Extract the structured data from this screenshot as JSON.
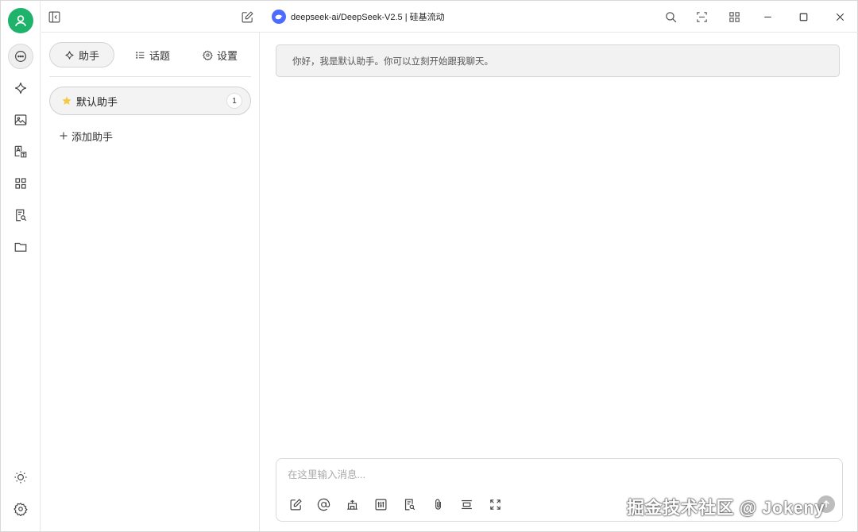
{
  "header": {
    "model_name": "deepseek-ai/DeepSeek-V2.5 | 硅基流动",
    "icons": [
      "sidebar-toggle-icon",
      "new-topic-icon",
      "search-icon",
      "scan-icon",
      "apps-icon",
      "minimize-icon",
      "maximize-icon",
      "close-icon"
    ]
  },
  "rail": {
    "icons": [
      "chat-icon",
      "sparkle-icon",
      "image-icon",
      "translate-icon",
      "grid-icon",
      "document-search-icon",
      "folder-icon",
      "theme-sun-icon",
      "settings-gear-icon"
    ],
    "active": "chat-icon"
  },
  "panel": {
    "tabs": [
      {
        "label": "助手",
        "icon": "sparkle-icon"
      },
      {
        "label": "话题",
        "icon": "list-icon"
      },
      {
        "label": "设置",
        "icon": "gear-icon"
      }
    ],
    "assistants": [
      {
        "label": "默认助手",
        "count": "1",
        "icon": "star-icon"
      }
    ],
    "add_label": "添加助手"
  },
  "chat": {
    "greeting": "你好，我是默认助手。你可以立刻开始跟我聊天。"
  },
  "composer": {
    "placeholder": "在这里输入消息...",
    "tools": [
      "edit-icon",
      "at-icon",
      "knowledge-icon",
      "adjust-icon",
      "document-search-icon",
      "attachment-icon",
      "clear-icon",
      "expand-icon"
    ]
  },
  "watermark": "掘金技术社区 @ Jokeny",
  "colors": {
    "avatar": "#1fb26b",
    "model_logo": "#4d6bfe",
    "star": "#f7c948"
  }
}
